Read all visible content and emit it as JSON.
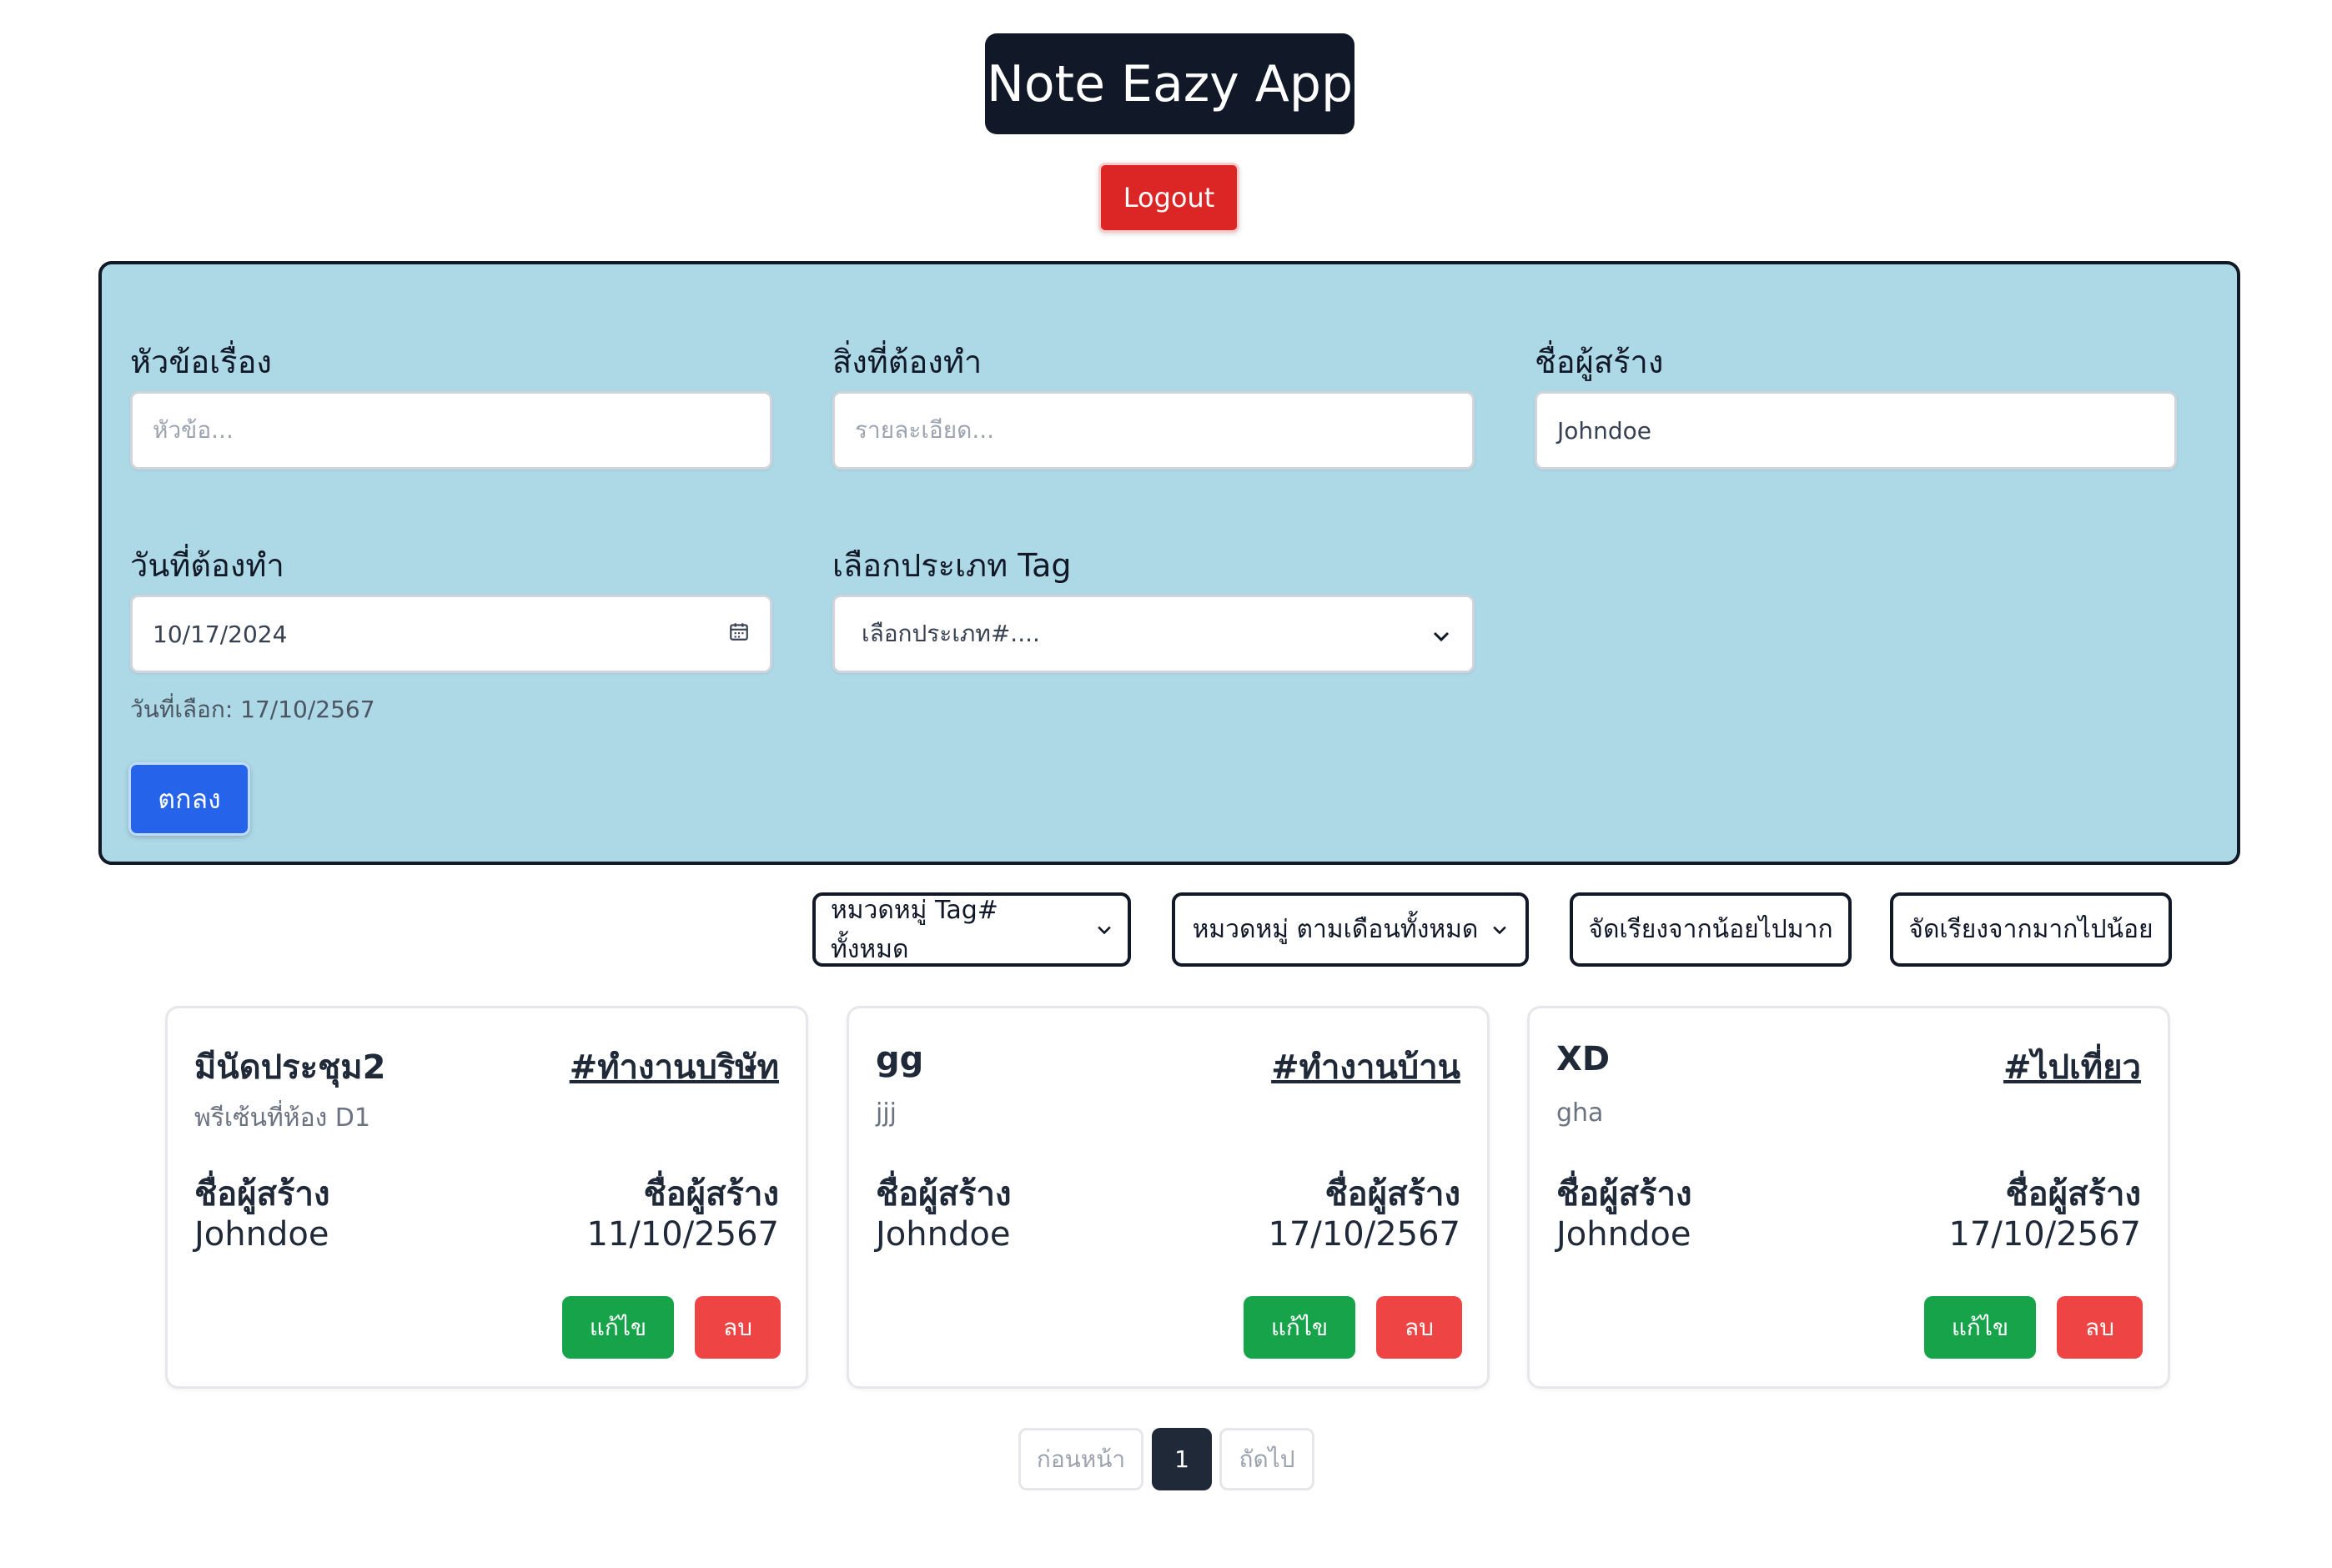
{
  "header": {
    "title": "Note Eazy App",
    "logout_label": "Logout"
  },
  "form": {
    "title_label": "หัวข้อเรื่อง",
    "title_placeholder": "หัวข้อ...",
    "todo_label": "สิ่งที่ต้องทำ",
    "todo_placeholder": "รายละเอียด...",
    "author_label": "ชื่อผู้สร้าง",
    "author_value": "Johndoe",
    "date_label": "วันที่ต้องทำ",
    "date_value": "10/17/2024",
    "date_hint": "วันที่เลือก: 17/10/2567",
    "tag_label": "เลือกประเภท Tag",
    "tag_select_value": "เลือกประเภท#....",
    "submit_label": "ตกลง"
  },
  "filters": {
    "tag_filter": "หมวดหมู่ Tag# ทั้งหมด",
    "month_filter": "หมวดหมู่ ตามเดือนทั้งหมด",
    "sort_asc": "จัดเรียงจากน้อยไปมาก",
    "sort_desc": "จัดเรียงจากมากไปน้อย"
  },
  "cards": [
    {
      "title": "มีนัดประชุม2",
      "tag": "#ทำงานบริษัท",
      "description": "พรีเซ้นที่ห้อง D1",
      "author_label": "ชื่อผู้สร้าง",
      "author": "Johndoe",
      "date_label": "ชื่อผู้สร้าง",
      "date": "11/10/2567",
      "edit_label": "แก้ไข",
      "delete_label": "ลบ"
    },
    {
      "title": "gg",
      "tag": "#ทำงานบ้าน",
      "description": "jjj",
      "author_label": "ชื่อผู้สร้าง",
      "author": "Johndoe",
      "date_label": "ชื่อผู้สร้าง",
      "date": "17/10/2567",
      "edit_label": "แก้ไข",
      "delete_label": "ลบ"
    },
    {
      "title": "XD",
      "tag": "#ไปเที่ยว",
      "description": "gha",
      "author_label": "ชื่อผู้สร้าง",
      "author": "Johndoe",
      "date_label": "ชื่อผู้สร้าง",
      "date": "17/10/2567",
      "edit_label": "แก้ไข",
      "delete_label": "ลบ"
    }
  ],
  "pagination": {
    "prev_label": "ก่อนหน้า",
    "current_page": "1",
    "next_label": "ถัดไป"
  }
}
